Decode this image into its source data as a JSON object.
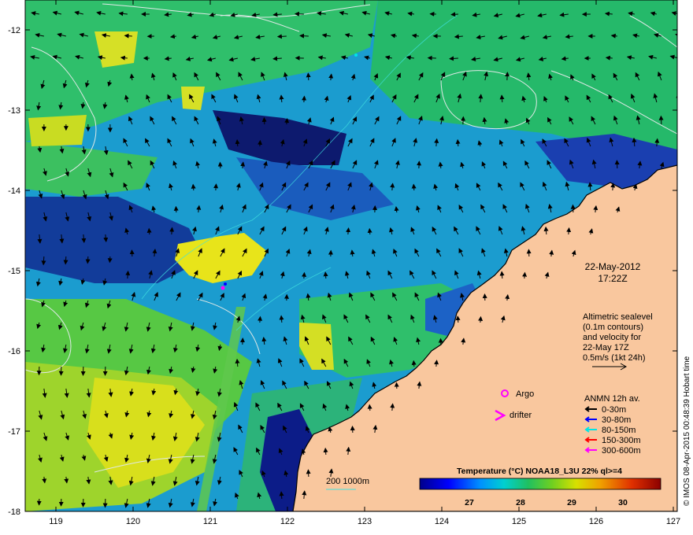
{
  "map": {
    "date": "22-May-2012",
    "time": "17:22Z",
    "altimetry_lines": [
      "Altimetric sealevel",
      "(0.1m contours)",
      "and velocity for",
      "22-May 17Z",
      "0.5m/s (1kt 24h)"
    ],
    "argo_label": "Argo",
    "drifter_label": "drifter",
    "anmn_title": "ANMN 12h av.",
    "anmn_items": [
      {
        "label": "0-30m",
        "color": "#000000"
      },
      {
        "label": "30-80m",
        "color": "#0000ff"
      },
      {
        "label": "80-150m",
        "color": "#00e5e5"
      },
      {
        "label": "150-300m",
        "color": "#ff0000"
      },
      {
        "label": "300-600m",
        "color": "#ff00ff"
      }
    ],
    "isobath_label": "200  1000m",
    "colorbar": {
      "title": "Temperature (°C) NOAA18_L3U 22% ql>=4",
      "ticks": [
        "27",
        "28",
        "29",
        "30"
      ]
    },
    "credit": "© IMOS 08-Apr-2015 00:48:39 Hobart time",
    "lat_ticks": [
      "-12",
      "-13",
      "-14",
      "-15",
      "-16",
      "-17",
      "-18"
    ],
    "lon_ticks": [
      "119",
      "120",
      "121",
      "122",
      "123",
      "124",
      "125",
      "126",
      "127"
    ],
    "colors": {
      "land": "#f9c79e",
      "coast": "#000000",
      "contour": "#dfe8e6",
      "isobath": "#40e0e0",
      "argo": "#ff00ff"
    }
  }
}
